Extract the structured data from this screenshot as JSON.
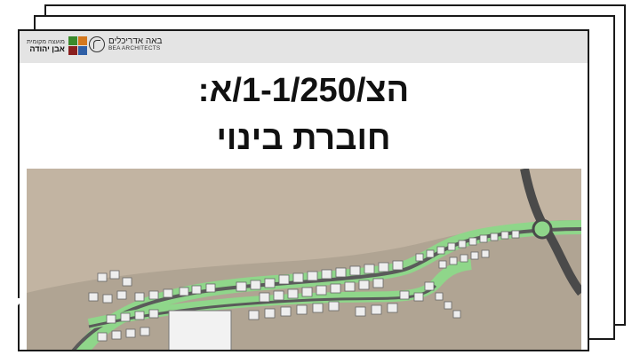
{
  "header": {
    "council_logo": {
      "icon": "council-emblem-icon",
      "small_text": "מועצה מקומית",
      "big_text": "אבן יהודה",
      "colors": [
        "#3a8a2c",
        "#d4781e",
        "#8a1f1f",
        "#2f5fa6"
      ]
    },
    "firm_logo": {
      "icon": "bea-logo-icon",
      "hebrew_text": "באה אדריכלים",
      "english_text": "BEA ARCHITECTS"
    }
  },
  "title": {
    "line1": "הצ/1-1/250/א:",
    "line2": "חוברת בינוי"
  },
  "plan": {
    "colors": {
      "ground": "#c2b4a2",
      "road": "#5a5a5a",
      "green": "#8fd68a",
      "building": "#eeeeee",
      "roof": "#d8d8d8"
    }
  }
}
